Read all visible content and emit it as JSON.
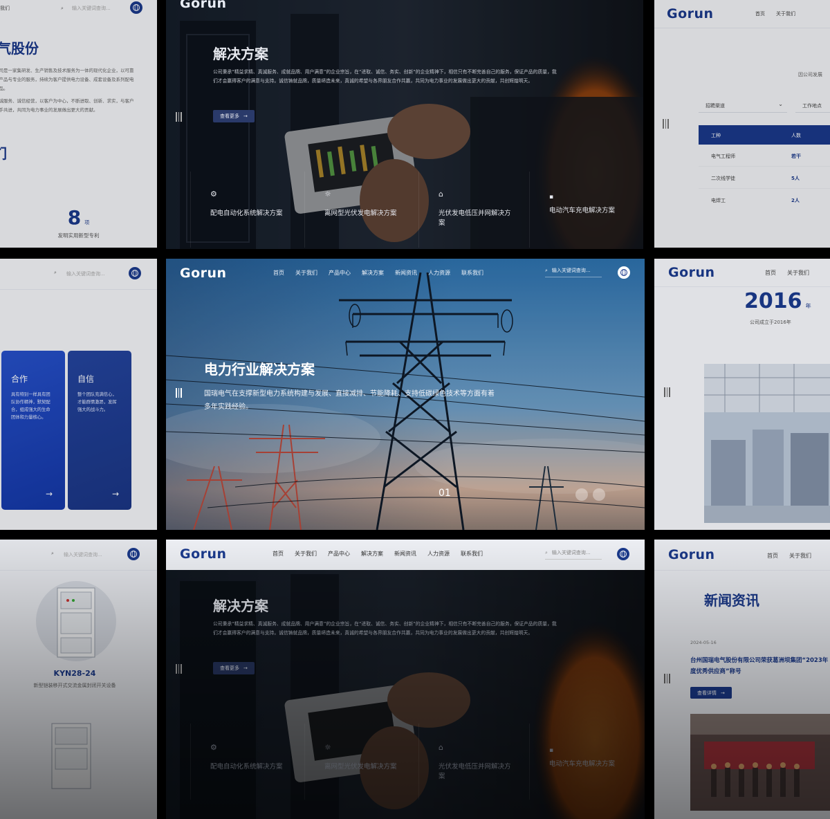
{
  "brand": {
    "logo": "Gorun",
    "primary": "#1b3a8c",
    "accent": "#f07a1b"
  },
  "nav": {
    "items": [
      "首页",
      "关于我们",
      "产品中心",
      "解决方案",
      "新闻资讯",
      "人力资源",
      "联系我们"
    ],
    "search_placeholder": "输入关键词查询...",
    "about_short": "关于我们"
  },
  "about_panel": {
    "title": "气股份",
    "para1": "公司是一家集研发、生产销售及技术服务为一体的现代化企业，以可靠的产品与专业的服务，持续为客户提供电力设备、成套设备及系列配电产品。",
    "para2": "真诚服务、诚信经营，以客户为中心，不断进取、创新、求实，与客户携手共进，共同为电力事业的发展做出更大的贡献。",
    "heading_fragment": "们",
    "stat_value": "8",
    "stat_unit": "项",
    "stat_label": "发明实用新型专利"
  },
  "solutions": {
    "title": "解决方案",
    "desc": "公司秉承“精益求精、真诚服务、成就品牌、用户满意”的企业宗旨，在“进取、诚信、务实、创新”的企业精神下，相信只有不断完善自己的服务，保证产品的质量，我们才会赢得客户的满意与支持。诚信铸就品牌，质量缔造未来，真诚的希望与各界朋友合作共赢，共同为电力事业的发展做出更大的贡献，共创辉煌明天。",
    "button": "查看更多",
    "items": [
      "配电自动化系统解决方案",
      "离网型光伏发电解决方案",
      "光伏发电低压并网解决方案",
      "电动汽车充电解决方案"
    ]
  },
  "recruit": {
    "intro": "因公司发展",
    "filter1": "招聘渠道",
    "filter2": "工作地点",
    "columns": [
      "工种",
      "人数"
    ],
    "rows": [
      [
        "电气工程师",
        "若干"
      ],
      [
        "二次线学徒",
        "5人"
      ],
      [
        "电焊工",
        "2人"
      ]
    ]
  },
  "values": {
    "cards": [
      {
        "title": "合作",
        "text": "具有特别一样具有团队协作精神，默契配合，组成强大的生命团体和力量核心。"
      },
      {
        "title": "自信",
        "text": "整个团队充满信心，才能群情激昂，发挥强大的战斗力。"
      }
    ]
  },
  "hero": {
    "title": "电力行业解决方案",
    "desc": "国瑞电气在支撑新型电力系统构建与发展、直接减排、节能降耗、支持低碳绿色技术等方面有着多年实践经验。",
    "slide": "01"
  },
  "history": {
    "year": "2016",
    "unit": "年",
    "caption": "公司成立于2016年"
  },
  "product": {
    "model": "KYN28-24",
    "name": "新型铠装移开式交流金属封闭开关设备"
  },
  "news": {
    "title": "新闻资讯",
    "date": "2024-05-16",
    "headline": "台州国瑞电气股份有限公司荣获葛洲坝集团“2023年度优秀供应商”称号",
    "button": "查看详情"
  }
}
